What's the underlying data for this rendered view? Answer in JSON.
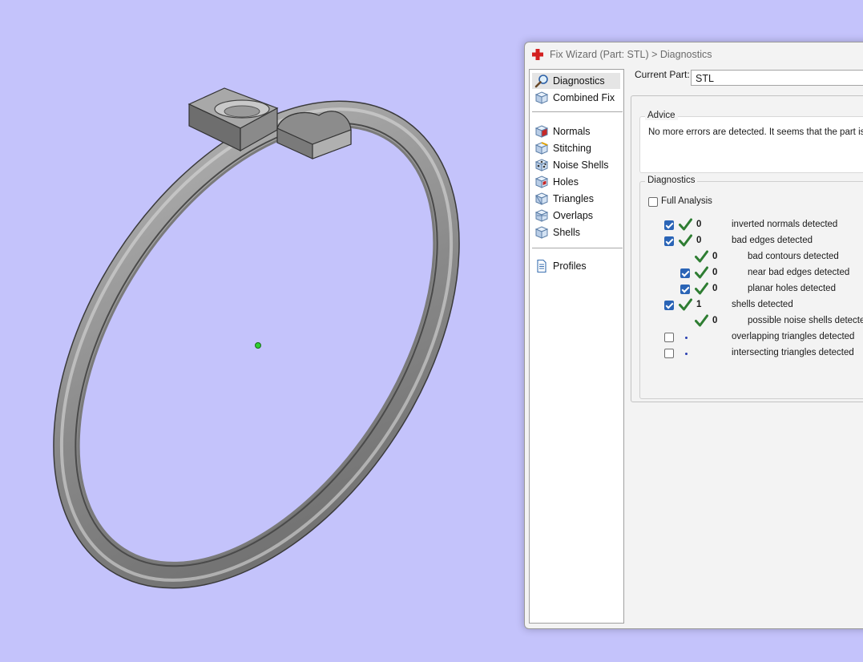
{
  "dialog": {
    "title": "Fix Wizard (Part: STL) > Diagnostics",
    "current_part_label": "Current Part:",
    "current_part_value": "STL"
  },
  "sidebar": {
    "items": [
      {
        "label": "Diagnostics",
        "icon": "magnifier-icon",
        "selected": true
      },
      {
        "label": "Combined Fix",
        "icon": "cube-icon"
      },
      {
        "label": "Normals",
        "icon": "normals-cube-icon"
      },
      {
        "label": "Stitching",
        "icon": "stitching-cube-icon"
      },
      {
        "label": "Noise Shells",
        "icon": "noise-shells-cube-icon"
      },
      {
        "label": "Holes",
        "icon": "holes-cube-icon"
      },
      {
        "label": "Triangles",
        "icon": "triangles-cube-icon"
      },
      {
        "label": "Overlaps",
        "icon": "overlaps-cube-icon"
      },
      {
        "label": "Shells",
        "icon": "shells-cube-icon"
      },
      {
        "label": "Profiles",
        "icon": "document-icon"
      }
    ]
  },
  "advice": {
    "title": "Advice",
    "text": "No more errors are detected. It seems that the part is c"
  },
  "diagnostics": {
    "title": "Diagnostics",
    "full_analysis_label": "Full Analysis",
    "full_analysis_checked": false,
    "rows": [
      {
        "label": "inverted normals detected",
        "count": "0",
        "checked": true,
        "status": "ok"
      },
      {
        "label": "bad edges detected",
        "count": "0",
        "checked": true,
        "status": "ok"
      },
      {
        "label": "bad contours detected",
        "count": "0",
        "checked": null,
        "status": "ok"
      },
      {
        "label": "near bad edges detected",
        "count": "0",
        "checked": true,
        "status": "ok"
      },
      {
        "label": "planar holes detected",
        "count": "0",
        "checked": true,
        "status": "ok"
      },
      {
        "label": "shells detected",
        "count": "1",
        "checked": true,
        "status": "ok"
      },
      {
        "label": "possible noise shells detected",
        "count": "0",
        "checked": null,
        "status": "ok"
      },
      {
        "label": "overlapping triangles detected",
        "count": "",
        "checked": false,
        "status": "pending"
      },
      {
        "label": "intersecting triangles detected",
        "count": "",
        "checked": false,
        "status": "pending"
      }
    ]
  },
  "colors": {
    "viewport_background": "#c4c3fb",
    "model_gray": "#8a8a8a",
    "check_green": "#2e7d32",
    "checkbox_blue": "#2a64b6",
    "pending_dot": "#2a3fb0",
    "app_icon_red": "#d32020"
  }
}
